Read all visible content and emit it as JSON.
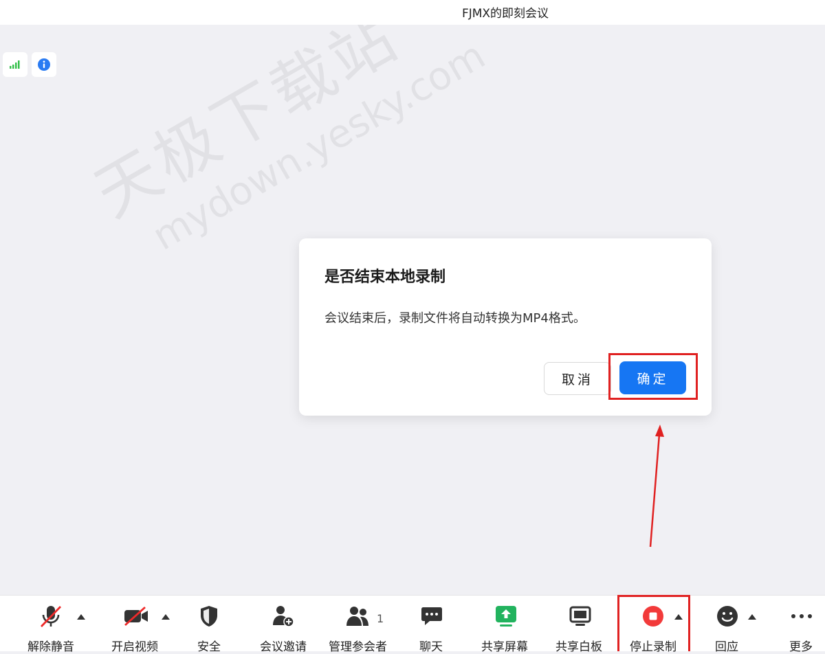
{
  "window": {
    "title": "FJMX的即刻会议"
  },
  "watermark": {
    "line1": "天极下载站",
    "line2": "mydown.yesky.com"
  },
  "status_icons": [
    {
      "name": "signal-strength-icon"
    },
    {
      "name": "info-icon"
    }
  ],
  "dialog": {
    "title": "是否结束本地录制",
    "message": "会议结束后，录制文件将自动转换为MP4格式。",
    "cancel_label": "取消",
    "ok_label": "确定"
  },
  "toolbar": {
    "unmute": "解除静音",
    "start_video": "开启视频",
    "security": "安全",
    "invite": "会议邀请",
    "participants": "管理参会者",
    "participants_count": "1",
    "chat": "聊天",
    "share_screen": "共享屏幕",
    "whiteboard": "共享白板",
    "stop_recording": "停止录制",
    "reactions": "回应",
    "more": "更多"
  },
  "colors": {
    "accent": "#1676f3",
    "annotation": "#e02121",
    "record": "#f23a3a",
    "share": "#22b35e"
  }
}
